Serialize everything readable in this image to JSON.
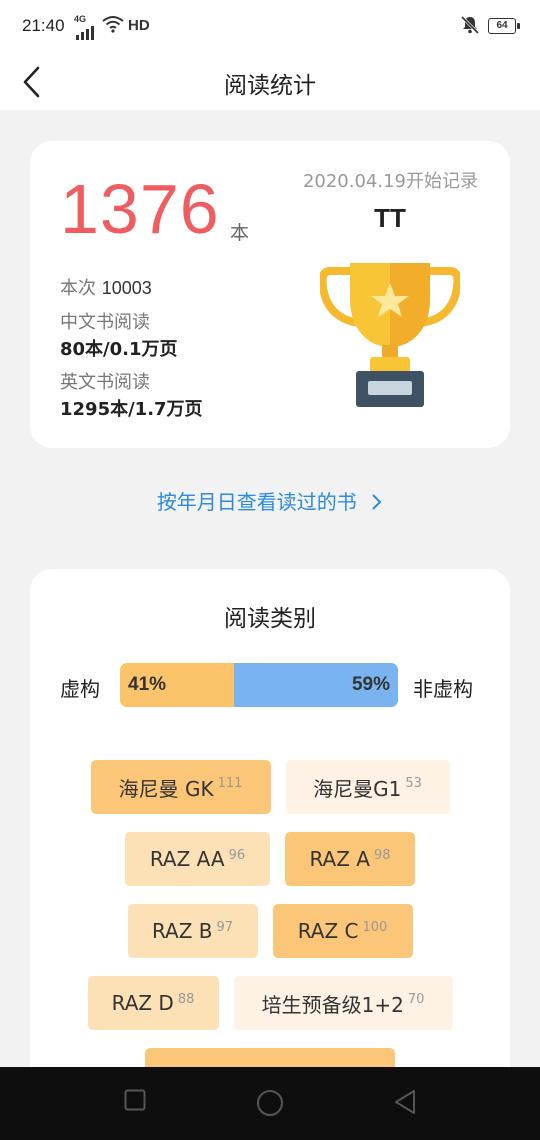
{
  "status_bar": {
    "time": "21:40",
    "network": "4G",
    "hd": "HD",
    "battery": "64"
  },
  "nav": {
    "title": "阅读统计"
  },
  "summary": {
    "total_count": "1376",
    "unit": "本",
    "since": "2020.04.19开始记录",
    "user_name": "TT",
    "this_time_label": "本次",
    "this_time_value": "10003",
    "chinese_label": "中文书阅读",
    "chinese_value": "80本/0.1万页",
    "english_label": "英文书阅读",
    "english_value": "1295本/1.7万页"
  },
  "view_books_link": "按年月日查看读过的书",
  "category": {
    "title": "阅读类别",
    "fiction_label": "虚构",
    "nonfiction_label": "非虚构",
    "fiction_percent": "41%",
    "nonfiction_percent": "59%",
    "fiction_ratio": 0.41,
    "tags": [
      {
        "label": "海尼曼 GK",
        "count": "111",
        "level": 3
      },
      {
        "label": "海尼曼G1",
        "count": "53",
        "level": 1
      },
      {
        "label": "RAZ AA",
        "count": "96",
        "level": 2
      },
      {
        "label": "RAZ A",
        "count": "98",
        "level": 3
      },
      {
        "label": "RAZ B",
        "count": "97",
        "level": 2
      },
      {
        "label": "RAZ C",
        "count": "100",
        "level": 3
      },
      {
        "label": "RAZ D",
        "count": "88",
        "level": 2
      },
      {
        "label": "培生预备级1+2",
        "count": "70",
        "level": 1
      }
    ]
  },
  "colors": {
    "accent_red": "#ef5d61",
    "link_blue": "#2b8be0",
    "fiction_orange": "#fbc36a",
    "nonfiction_blue": "#7ab4f0"
  },
  "icons": {
    "back": "chevron-left-icon",
    "trophy": "trophy-icon",
    "link_arrow": "chevron-right-icon"
  }
}
